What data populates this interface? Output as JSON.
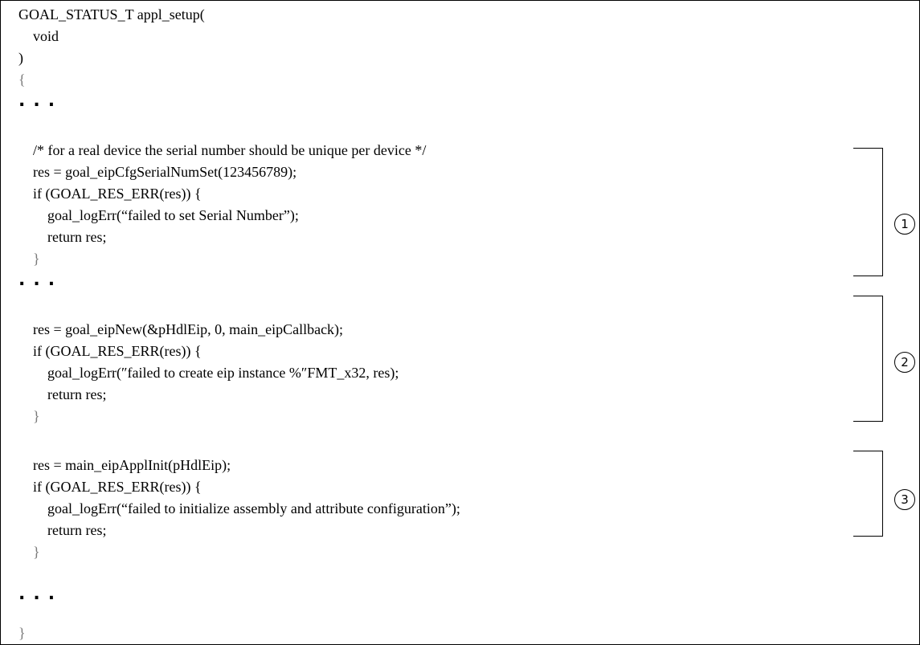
{
  "code": {
    "header": "GOAL_STATUS_T appl_setup(",
    "param": "    void",
    "close_paren": ")",
    "open_brace": "{",
    "ellipsis": "...",
    "comment": "    /* for a real device the serial number should be unique per device */",
    "serial_call": "    res = goal_eipCfgSerialNumSet(123456789);",
    "if_check": "    if (GOAL_RES_ERR(res)) {",
    "log_serial": "        goal_logErr(“failed to set Serial Number”);",
    "return_res": "        return res;",
    "inner_close": "    }",
    "eip_new": "    res = goal_eipNew(&pHdlEip, 0, main_eipCallback);",
    "log_eip": "        goal_logErr(″failed to create eip instance %″FMT_x32, res);",
    "appl_init": "    res = main_eipApplInit(pHdlEip);",
    "log_assembly": "        goal_logErr(“failed to initialize assembly and attribute configuration”);",
    "close_brace": "}"
  },
  "annotations": {
    "marker_1": "1",
    "marker_2": "2",
    "marker_3": "3"
  }
}
